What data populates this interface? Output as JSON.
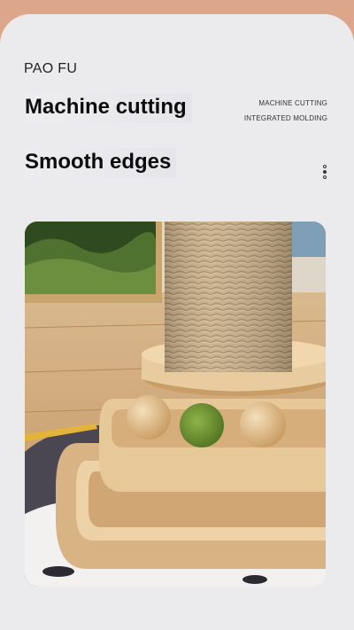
{
  "brand": "PAO FU",
  "headline_1": "Machine cutting",
  "headline_2": "Smooth edges",
  "detail_line_1": "MACHINE CUTTING",
  "detail_line_2": "INTEGRATED MOLDING",
  "colors": {
    "top_band": "#dca68b",
    "card": "#ebebee",
    "wood": "#e6c596",
    "sisal": "#c9b08a"
  }
}
